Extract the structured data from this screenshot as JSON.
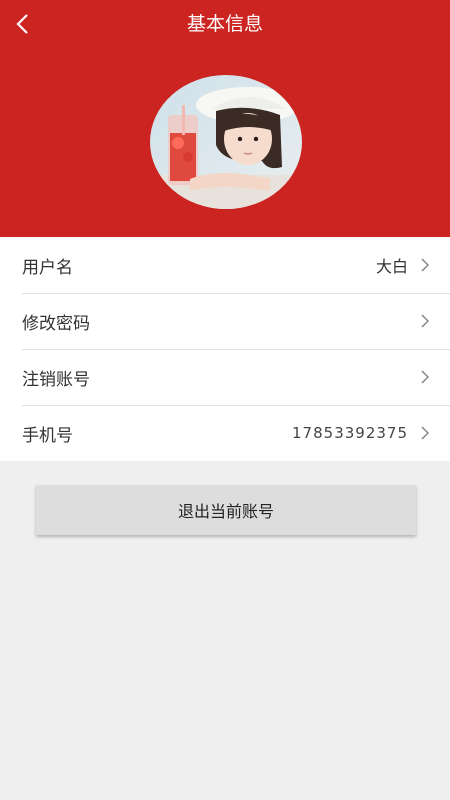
{
  "header": {
    "title": "基本信息",
    "background_color": "#cc2420"
  },
  "profile": {
    "avatar": "user-avatar-photo"
  },
  "rows": [
    {
      "label": "用户名",
      "value": "大白"
    },
    {
      "label": "修改密码",
      "value": ""
    },
    {
      "label": "注销账号",
      "value": ""
    },
    {
      "label": "手机号",
      "value": "17853392375"
    }
  ],
  "logout": {
    "label": "退出当前账号"
  }
}
